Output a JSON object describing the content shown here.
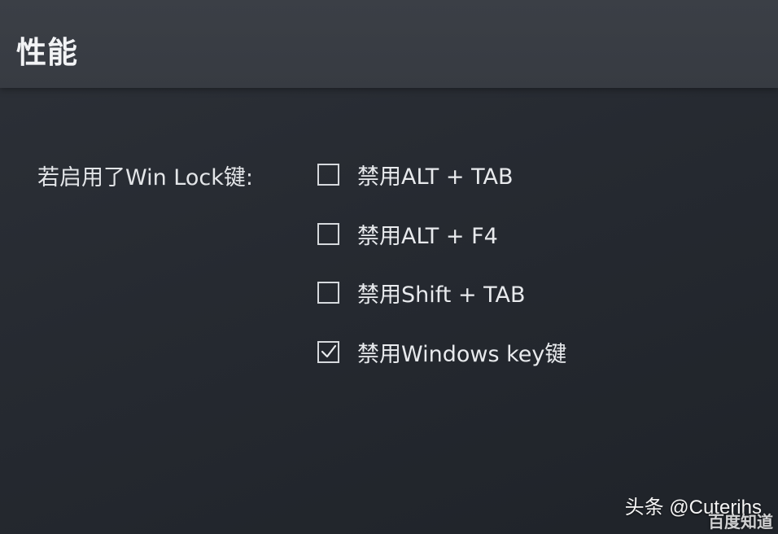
{
  "header": {
    "title": "性能"
  },
  "setting": {
    "label": "若启用了Win Lock键:"
  },
  "options": [
    {
      "label": "禁用ALT + TAB",
      "checked": false
    },
    {
      "label": "禁用ALT + F4",
      "checked": false
    },
    {
      "label": "禁用Shift + TAB",
      "checked": false
    },
    {
      "label": "禁用Windows key键",
      "checked": true
    }
  ],
  "watermark": {
    "text": "头条 @Cuterihs",
    "brand": "百度知道"
  },
  "colors": {
    "background": "#262a31",
    "header": "#3a3e45",
    "text": "#e8eaed",
    "checkbox_border": "#d6d9dd"
  }
}
